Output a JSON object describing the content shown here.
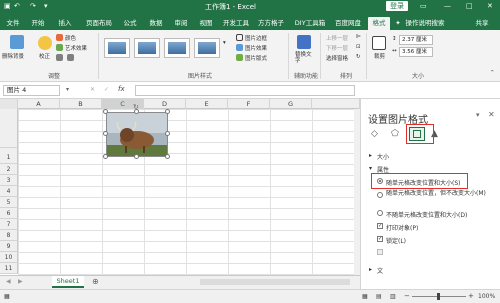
{
  "titlebar": {
    "doc_title": "工作簿1 - Excel",
    "login": "登录",
    "undo_icon": "undo-icon",
    "redo_icon": "redo-icon"
  },
  "tabs": [
    "文件",
    "开始",
    "插入",
    "页面布局",
    "公式",
    "数据",
    "审阅",
    "视图",
    "开发工具",
    "方方格子",
    "DIY工具箱",
    "百度网盘",
    "格式",
    "操作说明搜索",
    "共享"
  ],
  "ribbon": {
    "remove_bg": "删除背景",
    "correct": "校正",
    "color": "颜色",
    "art_effect": "艺术效果",
    "group_adjust": "调整",
    "group_picture_styles": "图片样式",
    "pic_border": "图片边框",
    "pic_effect": "图片效果",
    "pic_layout": "图片版式",
    "alt_text": "替换文字",
    "group_accessibility": "辅助功能",
    "bring_forward": "上移一层",
    "send_backward": "下移一层",
    "selection_pane": "选择窗格",
    "group_arrange": "排列",
    "crop": "裁剪",
    "height": "2.37 厘米",
    "width": "3.56 厘米",
    "group_size": "大小"
  },
  "formula_bar": {
    "name_box": "图片 4",
    "fx": "fx"
  },
  "grid": {
    "columns": [
      "A",
      "B",
      "C",
      "D",
      "E",
      "F",
      "G"
    ],
    "rows": [
      "1",
      "2",
      "3",
      "4",
      "5",
      "6",
      "7",
      "8",
      "9",
      "10",
      "11",
      "12",
      "13",
      "14",
      "15"
    ],
    "sheet_tab": "Sheet1"
  },
  "status": {
    "zoom": "100%"
  },
  "pane": {
    "title": "设置图片格式",
    "section_size": "大小",
    "section_props": "属性",
    "opt1": "随单元格改变位置和大小(S)",
    "opt2": "随单元格改变位置，但不改变大小(M)",
    "opt3": "不随单元格改变位置和大小(D)",
    "print_obj": "打印对象(P)",
    "locked": "锁定(L)",
    "section_text": "文"
  },
  "colors": {
    "excel_green": "#217346",
    "highlight_red": "#e0302a"
  }
}
